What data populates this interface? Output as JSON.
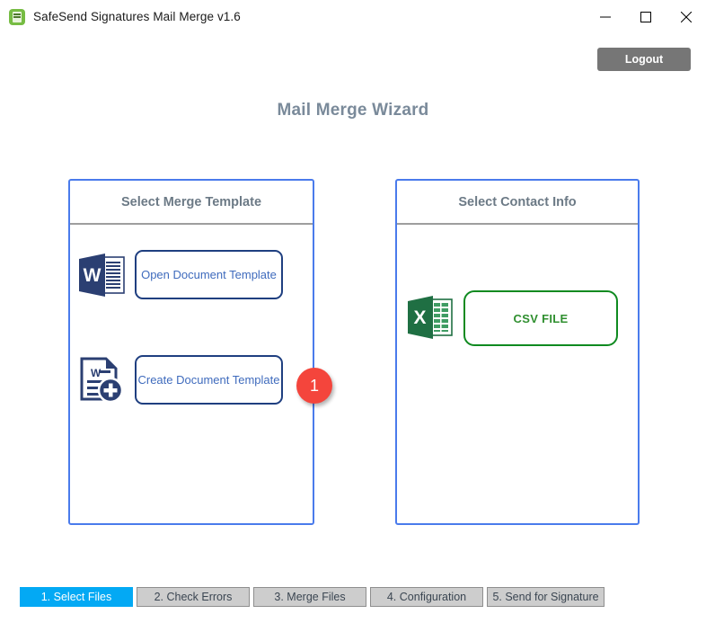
{
  "window": {
    "title": "SafeSend Signatures Mail Merge v1.6",
    "app_icon": "safesend-app-icon",
    "controls": {
      "minimize": "minimize-icon",
      "maximize": "maximize-icon",
      "close": "close-icon"
    }
  },
  "header": {
    "logout_label": "Logout",
    "page_title": "Mail Merge Wizard"
  },
  "panels": [
    {
      "id": "select-merge-template",
      "title": "Select Merge Template",
      "actions": [
        {
          "id": "open-document-template",
          "label": "Open Document Template",
          "icon": "word-document-icon",
          "style": "blue"
        },
        {
          "id": "create-document-template",
          "label": "Create Document Template",
          "icon": "word-document-add-icon",
          "style": "blue"
        }
      ]
    },
    {
      "id": "select-contact-info",
      "title": "Select Contact Info",
      "actions": [
        {
          "id": "csv-file",
          "label": "CSV FILE",
          "icon": "excel-spreadsheet-icon",
          "style": "green"
        }
      ]
    }
  ],
  "badge": {
    "number": "1"
  },
  "tabs": [
    {
      "label": "1. Select Files",
      "active": true
    },
    {
      "label": "2. Check Errors",
      "active": false
    },
    {
      "label": "3. Merge Files",
      "active": false
    },
    {
      "label": "4. Configuration",
      "active": false
    },
    {
      "label": "5. Send for Signature",
      "active": false
    }
  ],
  "colors": {
    "accent_blue": "#4a7bec",
    "tab_active": "#03a9f4",
    "badge_red": "#f4453c",
    "word_blue": "#2b3f72",
    "excel_green": "#1f6f43",
    "logout_gray": "#767676",
    "title_gray": "#7a8a9a"
  }
}
